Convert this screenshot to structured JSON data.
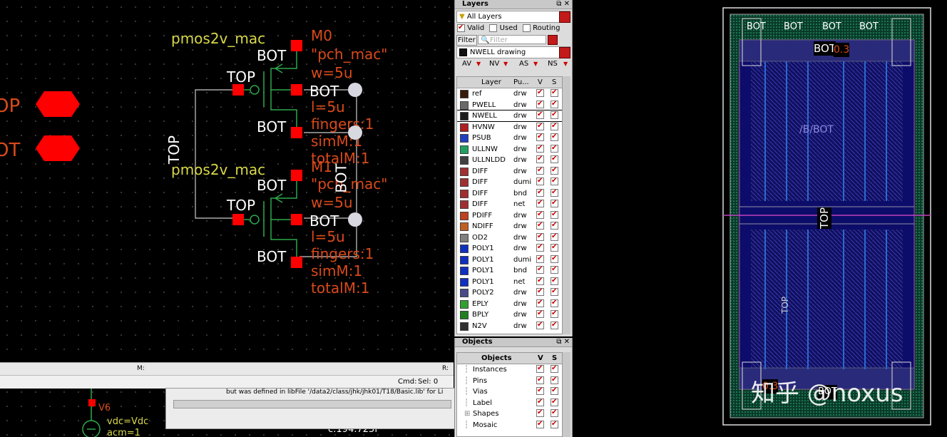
{
  "schematic": {
    "pins": [
      {
        "label": "OP"
      },
      {
        "label": "OT"
      }
    ],
    "devices": [
      {
        "cell": "pmos2v_mac",
        "inst": "M0",
        "model": "\"pch_mac\"",
        "w": "w=5u",
        "l": "l=5u",
        "fingers": "fingers:1",
        "simM": "simM:1",
        "totalM": "totalM:1",
        "bot_top": "BOT",
        "top": "TOP",
        "bot_mid": "BOT",
        "bot_low": "BOT"
      },
      {
        "cell": "pmos2v_mac",
        "inst": "M1",
        "model": "\"pch_mac\"",
        "w": "w=5u",
        "l": "l=5u",
        "fingers": "fingers:1",
        "simM": "simM:1",
        "totalM": "totalM:1",
        "bot_top": "BOT",
        "top": "TOP",
        "bot_mid": "BOT",
        "bot_low": "BOT"
      }
    ],
    "net_top": "TOP",
    "net_bot": "BOT",
    "vsource": {
      "name": "V6",
      "vdc": "vdc=Vdc",
      "acm": "acm=1"
    },
    "cursor_readout": "c:194.725f"
  },
  "cmd": {
    "mode_label": "M:",
    "right_label": "R:",
    "cmd_label": "Cmd:",
    "sel_label": "Sel: 0",
    "message": "but was defined in libFile '/data2/class/jhk/jhk01/T18/Basic.lib' for Li"
  },
  "layers_panel": {
    "title": "Layers",
    "filter_all": "All Layers",
    "valid": "Valid",
    "used": "Used",
    "routing": "Routing",
    "filter_btn": "Filter",
    "filter_placeholder": "Filter",
    "current_layer": "NWELL drawing",
    "view_tabs": [
      "AV",
      "NV",
      "AS",
      "NS"
    ],
    "col_layer": "Layer",
    "col_purpose": "Pu...",
    "col_v": "V",
    "col_s": "S",
    "rows": [
      {
        "name": "ref",
        "purpose": "drw",
        "color": "#3a1a0a"
      },
      {
        "name": "PWELL",
        "purpose": "drw",
        "color": "#6a6a6a"
      },
      {
        "name": "NWELL",
        "purpose": "drw",
        "color": "#1a1a1a"
      },
      {
        "name": "HVNW",
        "purpose": "drw",
        "color": "#b02020"
      },
      {
        "name": "PSUB",
        "purpose": "drw",
        "color": "#2040c0"
      },
      {
        "name": "ULLNW",
        "purpose": "drw",
        "color": "#20a060"
      },
      {
        "name": "ULLNLDD",
        "purpose": "drw",
        "color": "#404040"
      },
      {
        "name": "DIFF",
        "purpose": "drw",
        "color": "#a03030"
      },
      {
        "name": "DIFF",
        "purpose": "dumi",
        "color": "#a03030"
      },
      {
        "name": "DIFF",
        "purpose": "bnd",
        "color": "#a03030"
      },
      {
        "name": "DIFF",
        "purpose": "net",
        "color": "#a03030"
      },
      {
        "name": "PDIFF",
        "purpose": "drw",
        "color": "#c04020"
      },
      {
        "name": "NDIFF",
        "purpose": "drw",
        "color": "#c06020"
      },
      {
        "name": "OD2",
        "purpose": "drw",
        "color": "#808080"
      },
      {
        "name": "POLY1",
        "purpose": "drw",
        "color": "#1030c0"
      },
      {
        "name": "POLY1",
        "purpose": "dumi",
        "color": "#1030c0"
      },
      {
        "name": "POLY1",
        "purpose": "bnd",
        "color": "#1030c0"
      },
      {
        "name": "POLY1",
        "purpose": "net",
        "color": "#1030c0"
      },
      {
        "name": "POLY2",
        "purpose": "drw",
        "color": "#4a4a8a"
      },
      {
        "name": "EPLY",
        "purpose": "drw",
        "color": "#30a030"
      },
      {
        "name": "BPLY",
        "purpose": "drw",
        "color": "#208020"
      },
      {
        "name": "N2V",
        "purpose": "drw",
        "color": "#303030"
      }
    ]
  },
  "objects_panel": {
    "title": "Objects",
    "col_objects": "Objects",
    "col_v": "V",
    "col_s": "S",
    "rows": [
      "Instances",
      "Pins",
      "Vias",
      "Label",
      "Shapes",
      "Mosaic"
    ]
  },
  "layout": {
    "labels": [
      "BOT",
      "BOT",
      "BOT",
      "BOT",
      "BOT",
      "TOP",
      "0.3",
      "/B/BOT",
      "TOP",
      "BOT",
      "0.3"
    ],
    "watermark": "知乎 @noxus"
  }
}
